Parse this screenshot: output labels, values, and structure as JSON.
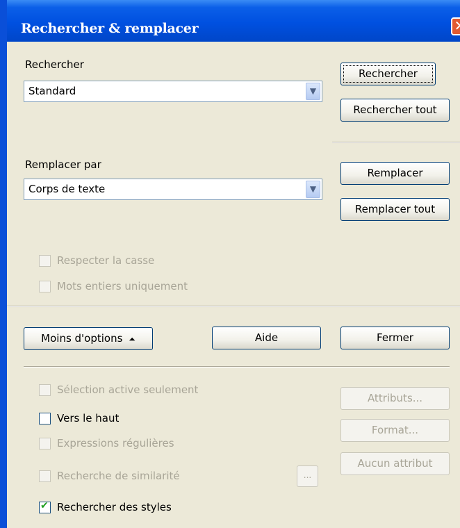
{
  "window": {
    "title": "Rechercher & remplacer",
    "close_glyph": "✕"
  },
  "search": {
    "label": "Rechercher",
    "value": "Standard",
    "dropdown_icon": "chevron-down-icon"
  },
  "replace": {
    "label": "Remplacer par",
    "value": "Corps de texte",
    "dropdown_icon": "chevron-down-icon"
  },
  "buttons": {
    "search": "Rechercher",
    "search_all": "Rechercher tout",
    "replace": "Remplacer",
    "replace_all": "Remplacer tout",
    "fewer_options": "Moins d'options",
    "fewer_options_icon": "double-chevron-up-icon",
    "help": "Aide",
    "close": "Fermer",
    "attributes": "Attributs...",
    "format": "Format...",
    "no_attributes": "Aucun attribut",
    "similarity_settings": "..."
  },
  "options": {
    "match_case": {
      "label": "Respecter la casse",
      "checked": false,
      "enabled": false
    },
    "whole_words": {
      "label": "Mots entiers uniquement",
      "checked": false,
      "enabled": false
    },
    "current_selection": {
      "label": "Sélection active seulement",
      "checked": false,
      "enabled": false
    },
    "backwards": {
      "label": "Vers le haut",
      "checked": false,
      "enabled": true
    },
    "regex": {
      "label": "Expressions régulières",
      "checked": false,
      "enabled": false
    },
    "similarity": {
      "label": "Recherche de similarité",
      "checked": false,
      "enabled": false
    },
    "styles": {
      "label": "Rechercher des styles",
      "checked": true,
      "enabled": true
    }
  },
  "colors": {
    "titlebar": "#0050e0",
    "dialog_bg": "#ece9d8",
    "close": "#e25a32",
    "check": "#21a121"
  }
}
